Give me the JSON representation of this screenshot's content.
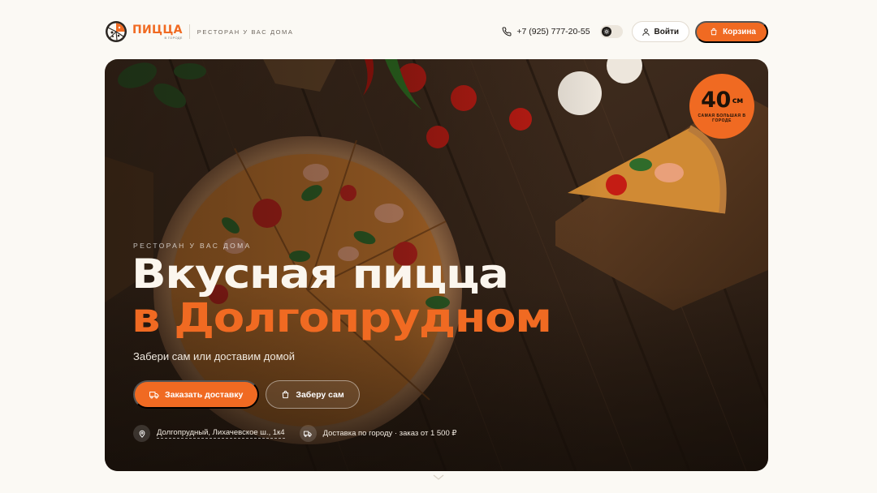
{
  "brand": {
    "logo_title": "ПИЦЦА",
    "logo_sub": "В ГОРОДЕ",
    "tagline": "РЕСТОРАН У ВАС ДОМА",
    "accent": "#f06a22"
  },
  "header": {
    "phone": "+7 (925) 777-20-55",
    "phone_icon": "phone-icon",
    "theme_icon": "sun-icon",
    "login_label": "Войти",
    "login_icon": "user-icon",
    "cart_label": "Корзина",
    "cart_icon": "bag-icon"
  },
  "hero": {
    "badge_number": "40",
    "badge_unit": "см",
    "badge_caption": "САМАЯ БОЛЬШАЯ В ГОРОДЕ",
    "eyebrow": "РЕСТОРАН У ВАС ДОМА",
    "headline_line1": "Вкусная пицца",
    "headline_line2": "в Долгопрудном",
    "subtitle": "Забери сам или доставим домой",
    "delivery_button": "Заказать доставку",
    "pickup_button": "Заберу сам",
    "address": "Долгопрудный, Лихачевское ш., 1к4",
    "delivery_info": "Доставка по городу · заказ от 1 500 ₽"
  }
}
